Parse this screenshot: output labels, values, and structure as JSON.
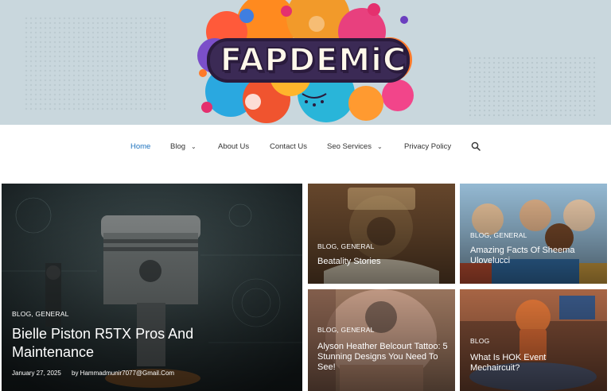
{
  "site": {
    "logo_text": "FAPDEMiC"
  },
  "nav": {
    "items": [
      {
        "label": "Home",
        "active": true
      },
      {
        "label": "Blog",
        "dropdown": true
      },
      {
        "label": "About Us"
      },
      {
        "label": "Contact Us"
      },
      {
        "label": "Seo Services",
        "dropdown": true
      },
      {
        "label": "Privacy Policy"
      }
    ],
    "search_icon": "search-icon",
    "active_color": "#1e73be"
  },
  "posts": {
    "featured": {
      "category": "BLOG, GENERAL",
      "title": "Bielle Piston R5TX Pros And Maintenance",
      "date": "January 27, 2025",
      "author": "by Hammadmunir7077@Gmail.Com"
    },
    "grid": [
      {
        "category": "BLOG, GENERAL",
        "title": "Beatality Stories"
      },
      {
        "category": "BLOG, GENERAL",
        "title": "Amazing Facts Of Sheema Ulovelucci"
      },
      {
        "category": "BLOG, GENERAL",
        "title": "Alyson Heather Belcourt Tattoo: 5 Stunning Designs You Need To See!"
      },
      {
        "category": "BLOG",
        "title": "What Is HOK Event Mechaircuit?"
      }
    ]
  }
}
